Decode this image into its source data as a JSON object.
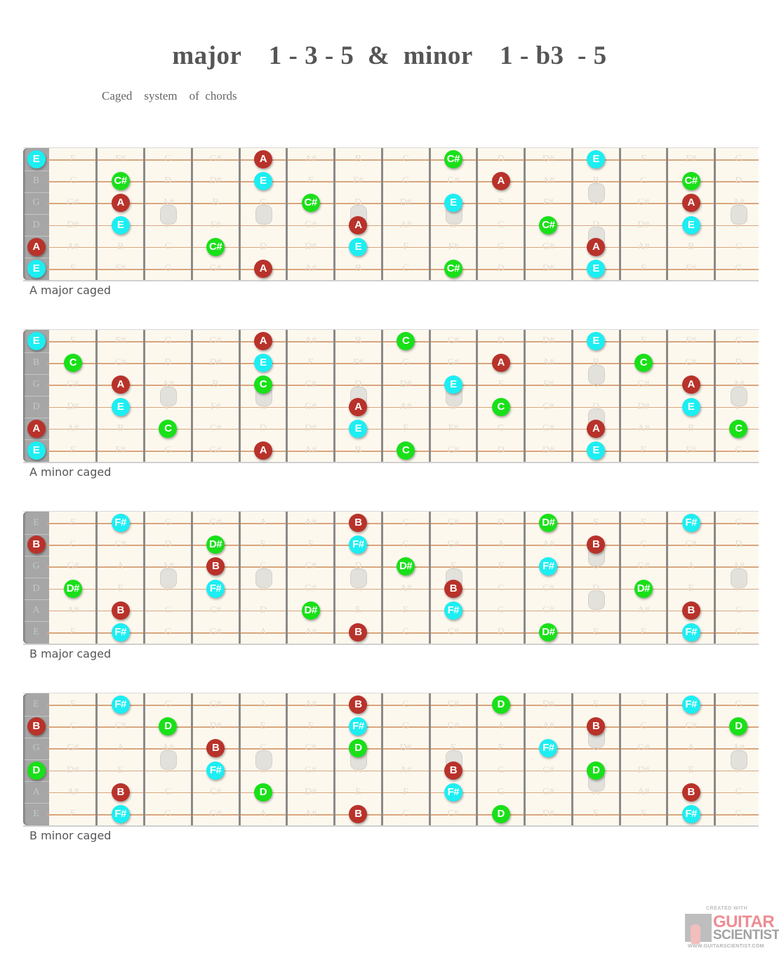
{
  "title": "major    1 - 3 - 5  &  minor    1 - b3  - 5",
  "subtitle": "Caged    system    of  chords",
  "tuning": [
    "E",
    "B",
    "G",
    "D",
    "A",
    "E"
  ],
  "chromatic": [
    "C",
    "C#",
    "D",
    "D#",
    "E",
    "F",
    "F#",
    "G",
    "G#",
    "A",
    "A#",
    "B"
  ],
  "fret_count": 15,
  "inlay_frets": {
    "single": [
      3,
      5,
      7,
      9,
      15
    ],
    "double": [
      12
    ]
  },
  "colors": {
    "root": "#b8322a",
    "third": "#19e019",
    "fifth": "#1ceef2"
  },
  "boards": [
    {
      "label": "A major caged",
      "notes": [
        {
          "string": 0,
          "fret": 0,
          "name": "E",
          "role": "fifth"
        },
        {
          "string": 0,
          "fret": 5,
          "name": "A",
          "role": "root"
        },
        {
          "string": 0,
          "fret": 9,
          "name": "C#",
          "role": "third"
        },
        {
          "string": 0,
          "fret": 12,
          "name": "E",
          "role": "fifth"
        },
        {
          "string": 1,
          "fret": 2,
          "name": "C#",
          "role": "third"
        },
        {
          "string": 1,
          "fret": 5,
          "name": "E",
          "role": "fifth"
        },
        {
          "string": 1,
          "fret": 10,
          "name": "A",
          "role": "root"
        },
        {
          "string": 1,
          "fret": 14,
          "name": "C#",
          "role": "third"
        },
        {
          "string": 2,
          "fret": 2,
          "name": "A",
          "role": "root"
        },
        {
          "string": 2,
          "fret": 6,
          "name": "C#",
          "role": "third"
        },
        {
          "string": 2,
          "fret": 9,
          "name": "E",
          "role": "fifth"
        },
        {
          "string": 2,
          "fret": 14,
          "name": "A",
          "role": "root"
        },
        {
          "string": 3,
          "fret": 2,
          "name": "E",
          "role": "fifth"
        },
        {
          "string": 3,
          "fret": 7,
          "name": "A",
          "role": "root"
        },
        {
          "string": 3,
          "fret": 11,
          "name": "C#",
          "role": "third"
        },
        {
          "string": 3,
          "fret": 14,
          "name": "E",
          "role": "fifth"
        },
        {
          "string": 4,
          "fret": 0,
          "name": "A",
          "role": "root"
        },
        {
          "string": 4,
          "fret": 4,
          "name": "C#",
          "role": "third"
        },
        {
          "string": 4,
          "fret": 7,
          "name": "E",
          "role": "fifth"
        },
        {
          "string": 4,
          "fret": 12,
          "name": "A",
          "role": "root"
        },
        {
          "string": 5,
          "fret": 0,
          "name": "E",
          "role": "fifth"
        },
        {
          "string": 5,
          "fret": 5,
          "name": "A",
          "role": "root"
        },
        {
          "string": 5,
          "fret": 9,
          "name": "C#",
          "role": "third"
        },
        {
          "string": 5,
          "fret": 12,
          "name": "E",
          "role": "fifth"
        }
      ]
    },
    {
      "label": "A minor caged",
      "notes": [
        {
          "string": 0,
          "fret": 0,
          "name": "E",
          "role": "fifth"
        },
        {
          "string": 0,
          "fret": 5,
          "name": "A",
          "role": "root"
        },
        {
          "string": 0,
          "fret": 8,
          "name": "C",
          "role": "third"
        },
        {
          "string": 0,
          "fret": 12,
          "name": "E",
          "role": "fifth"
        },
        {
          "string": 1,
          "fret": 1,
          "name": "C",
          "role": "third"
        },
        {
          "string": 1,
          "fret": 5,
          "name": "E",
          "role": "fifth"
        },
        {
          "string": 1,
          "fret": 10,
          "name": "A",
          "role": "root"
        },
        {
          "string": 1,
          "fret": 13,
          "name": "C",
          "role": "third"
        },
        {
          "string": 2,
          "fret": 2,
          "name": "A",
          "role": "root"
        },
        {
          "string": 2,
          "fret": 5,
          "name": "C",
          "role": "third"
        },
        {
          "string": 2,
          "fret": 9,
          "name": "E",
          "role": "fifth"
        },
        {
          "string": 2,
          "fret": 14,
          "name": "A",
          "role": "root"
        },
        {
          "string": 3,
          "fret": 2,
          "name": "E",
          "role": "fifth"
        },
        {
          "string": 3,
          "fret": 7,
          "name": "A",
          "role": "root"
        },
        {
          "string": 3,
          "fret": 10,
          "name": "C",
          "role": "third"
        },
        {
          "string": 3,
          "fret": 14,
          "name": "E",
          "role": "fifth"
        },
        {
          "string": 4,
          "fret": 0,
          "name": "A",
          "role": "root"
        },
        {
          "string": 4,
          "fret": 3,
          "name": "C",
          "role": "third"
        },
        {
          "string": 4,
          "fret": 7,
          "name": "E",
          "role": "fifth"
        },
        {
          "string": 4,
          "fret": 12,
          "name": "A",
          "role": "root"
        },
        {
          "string": 4,
          "fret": 15,
          "name": "C",
          "role": "third"
        },
        {
          "string": 5,
          "fret": 0,
          "name": "E",
          "role": "fifth"
        },
        {
          "string": 5,
          "fret": 5,
          "name": "A",
          "role": "root"
        },
        {
          "string": 5,
          "fret": 8,
          "name": "C",
          "role": "third"
        },
        {
          "string": 5,
          "fret": 12,
          "name": "E",
          "role": "fifth"
        }
      ]
    },
    {
      "label": "B major caged",
      "notes": [
        {
          "string": 0,
          "fret": 2,
          "name": "F#",
          "role": "fifth"
        },
        {
          "string": 0,
          "fret": 7,
          "name": "B",
          "role": "root"
        },
        {
          "string": 0,
          "fret": 11,
          "name": "D#",
          "role": "third"
        },
        {
          "string": 0,
          "fret": 14,
          "name": "F#",
          "role": "fifth"
        },
        {
          "string": 1,
          "fret": 0,
          "name": "B",
          "role": "root"
        },
        {
          "string": 1,
          "fret": 4,
          "name": "D#",
          "role": "third"
        },
        {
          "string": 1,
          "fret": 7,
          "name": "F#",
          "role": "fifth"
        },
        {
          "string": 1,
          "fret": 12,
          "name": "B",
          "role": "root"
        },
        {
          "string": 2,
          "fret": 4,
          "name": "B",
          "role": "root"
        },
        {
          "string": 2,
          "fret": 8,
          "name": "D#",
          "role": "third"
        },
        {
          "string": 2,
          "fret": 11,
          "name": "F#",
          "role": "fifth"
        },
        {
          "string": 3,
          "fret": 1,
          "name": "D#",
          "role": "third"
        },
        {
          "string": 3,
          "fret": 4,
          "name": "F#",
          "role": "fifth"
        },
        {
          "string": 3,
          "fret": 9,
          "name": "B",
          "role": "root"
        },
        {
          "string": 3,
          "fret": 13,
          "name": "D#",
          "role": "third"
        },
        {
          "string": 4,
          "fret": 2,
          "name": "B",
          "role": "root"
        },
        {
          "string": 4,
          "fret": 6,
          "name": "D#",
          "role": "third"
        },
        {
          "string": 4,
          "fret": 9,
          "name": "F#",
          "role": "fifth"
        },
        {
          "string": 4,
          "fret": 14,
          "name": "B",
          "role": "root"
        },
        {
          "string": 5,
          "fret": 2,
          "name": "F#",
          "role": "fifth"
        },
        {
          "string": 5,
          "fret": 7,
          "name": "B",
          "role": "root"
        },
        {
          "string": 5,
          "fret": 11,
          "name": "D#",
          "role": "third"
        },
        {
          "string": 5,
          "fret": 14,
          "name": "F#",
          "role": "fifth"
        }
      ]
    },
    {
      "label": "B minor caged",
      "notes": [
        {
          "string": 0,
          "fret": 2,
          "name": "F#",
          "role": "fifth"
        },
        {
          "string": 0,
          "fret": 7,
          "name": "B",
          "role": "root"
        },
        {
          "string": 0,
          "fret": 10,
          "name": "D",
          "role": "third"
        },
        {
          "string": 0,
          "fret": 14,
          "name": "F#",
          "role": "fifth"
        },
        {
          "string": 1,
          "fret": 0,
          "name": "B",
          "role": "root"
        },
        {
          "string": 1,
          "fret": 3,
          "name": "D",
          "role": "third"
        },
        {
          "string": 1,
          "fret": 7,
          "name": "F#",
          "role": "fifth"
        },
        {
          "string": 1,
          "fret": 12,
          "name": "B",
          "role": "root"
        },
        {
          "string": 1,
          "fret": 15,
          "name": "D",
          "role": "third"
        },
        {
          "string": 2,
          "fret": 4,
          "name": "B",
          "role": "root"
        },
        {
          "string": 2,
          "fret": 7,
          "name": "D",
          "role": "third"
        },
        {
          "string": 2,
          "fret": 11,
          "name": "F#",
          "role": "fifth"
        },
        {
          "string": 3,
          "fret": 0,
          "name": "D",
          "role": "third"
        },
        {
          "string": 3,
          "fret": 4,
          "name": "F#",
          "role": "fifth"
        },
        {
          "string": 3,
          "fret": 9,
          "name": "B",
          "role": "root"
        },
        {
          "string": 3,
          "fret": 12,
          "name": "D",
          "role": "third"
        },
        {
          "string": 4,
          "fret": 2,
          "name": "B",
          "role": "root"
        },
        {
          "string": 4,
          "fret": 5,
          "name": "D",
          "role": "third"
        },
        {
          "string": 4,
          "fret": 9,
          "name": "F#",
          "role": "fifth"
        },
        {
          "string": 4,
          "fret": 14,
          "name": "B",
          "role": "root"
        },
        {
          "string": 5,
          "fret": 2,
          "name": "F#",
          "role": "fifth"
        },
        {
          "string": 5,
          "fret": 7,
          "name": "B",
          "role": "root"
        },
        {
          "string": 5,
          "fret": 10,
          "name": "D",
          "role": "third"
        },
        {
          "string": 5,
          "fret": 14,
          "name": "F#",
          "role": "fifth"
        }
      ]
    }
  ],
  "logo": {
    "created_with": "CREATED WITH",
    "brand_line1": "GUITAR",
    "brand_line2": "SCIENTIST",
    "url": "WWW.GUITARSCIENTIST.COM"
  }
}
